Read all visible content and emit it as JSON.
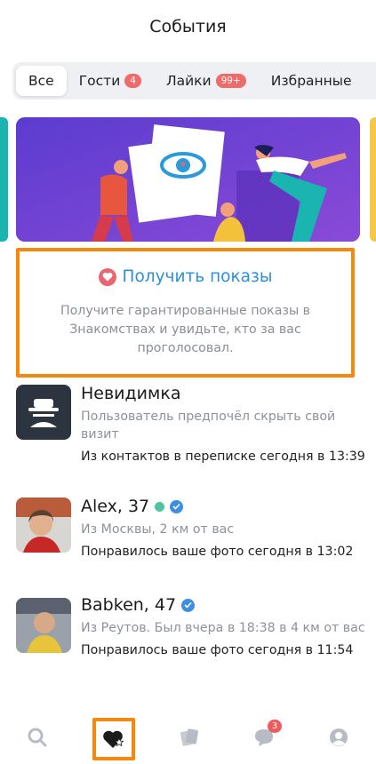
{
  "header": {
    "title": "События"
  },
  "tabs": [
    {
      "label": "Все",
      "badge": null,
      "active": true
    },
    {
      "label": "Гости",
      "badge": "4",
      "active": false
    },
    {
      "label": "Лайки",
      "badge": "99+",
      "active": false
    },
    {
      "label": "Избранные",
      "badge": null,
      "active": false
    }
  ],
  "promo": {
    "title": "Получить показы",
    "description": "Получите гарантированные показы в Знакомствах и увидьте, кто за вас проголосовал."
  },
  "events": [
    {
      "name": "Невидимка",
      "subtitle": "Пользователь предпочёл скрыть свой визит",
      "event": "Из контактов в переписке сегодня в 13:39"
    },
    {
      "name": "Alex, 37",
      "subtitle": "Из Москвы, 2 км от вас",
      "event": "Понравилось ваше фото сегодня в 13:02"
    },
    {
      "name": "Babken, 47",
      "subtitle": "Из Реутов. Был вчера в 18:38 в 4 км от вас",
      "event": "Понравилось ваше фото сегодня в 11:54"
    }
  ],
  "tabbar": {
    "items": [
      "search-icon",
      "heart-star-icon",
      "cards-icon",
      "chat-icon",
      "profile-icon"
    ],
    "messages_badge": "3"
  },
  "colors": {
    "accent": "#2b90d9",
    "highlight": "#f5890d",
    "badge": "#ef6a6a",
    "banner": "#6b3fd6"
  }
}
